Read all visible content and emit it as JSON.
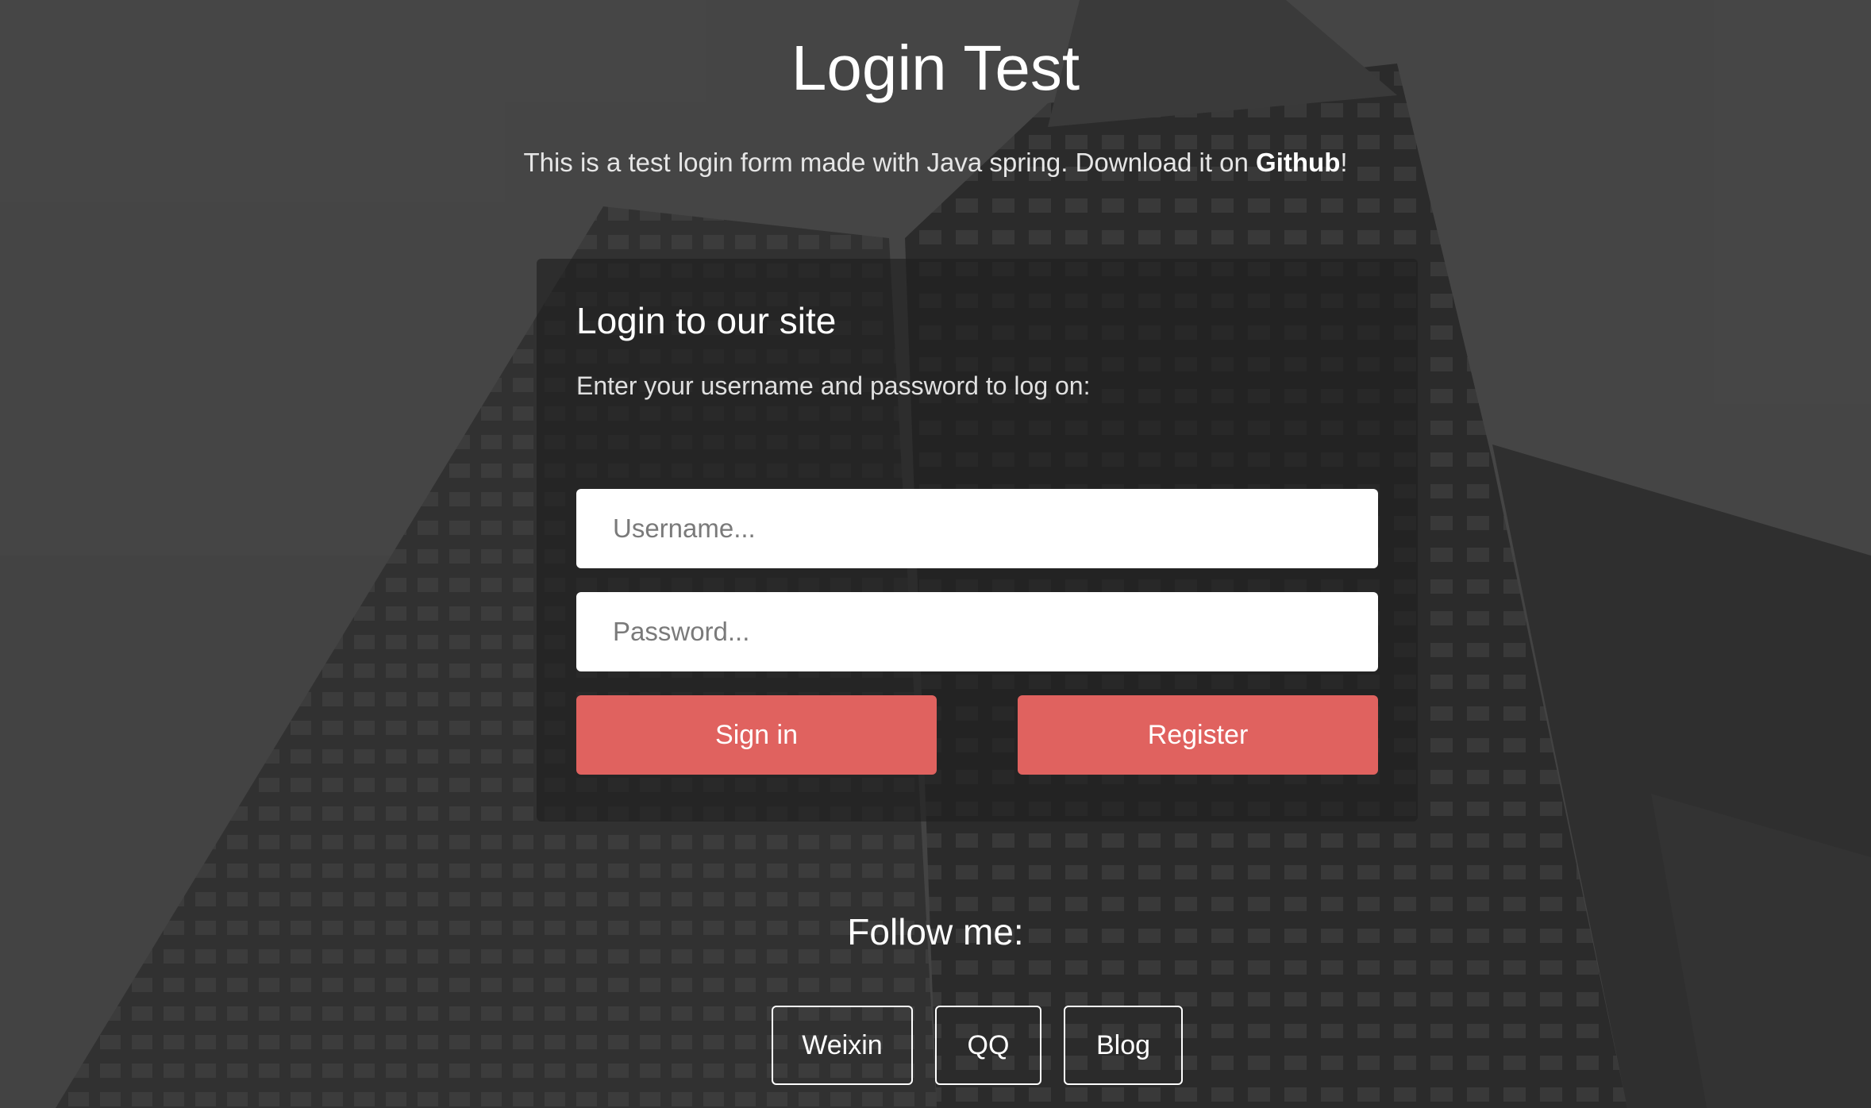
{
  "header": {
    "title": "Login Test",
    "subtitle_prefix": "This is a test login form made with Java spring. Download it on ",
    "subtitle_link": "Github",
    "subtitle_suffix": "!"
  },
  "login_panel": {
    "heading": "Login to our site",
    "description": "Enter your username and password to log on:",
    "username_placeholder": "Username...",
    "password_placeholder": "Password...",
    "signin_label": "Sign in",
    "register_label": "Register"
  },
  "follow": {
    "heading": "Follow me:",
    "links": [
      {
        "label": "Weixin"
      },
      {
        "label": "QQ"
      },
      {
        "label": "Blog"
      }
    ]
  },
  "colors": {
    "accent": "#e0625f",
    "panel_background": "#1e1e1e",
    "text": "#ffffff"
  }
}
